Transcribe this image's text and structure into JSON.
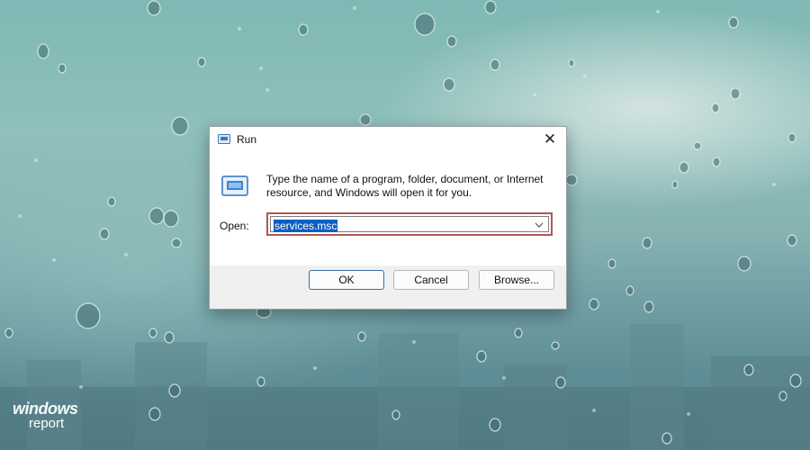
{
  "dialog": {
    "title": "Run",
    "description": "Type the name of a program, folder, document, or Internet resource, and Windows will open it for you.",
    "open_label": "Open:",
    "open_value": "services.msc",
    "close_glyph": "✕",
    "buttons": {
      "ok": "OK",
      "cancel": "Cancel",
      "browse": "Browse..."
    }
  },
  "watermark": {
    "line1": "windows",
    "line2": "report"
  },
  "colors": {
    "highlight": "#0a5fc4",
    "annotation_border": "#b05656",
    "primary_button_border": "#3a6ea5"
  },
  "icons": [
    "run-app-icon",
    "close-icon",
    "run-program-icon",
    "dropdown-arrow-icon"
  ]
}
